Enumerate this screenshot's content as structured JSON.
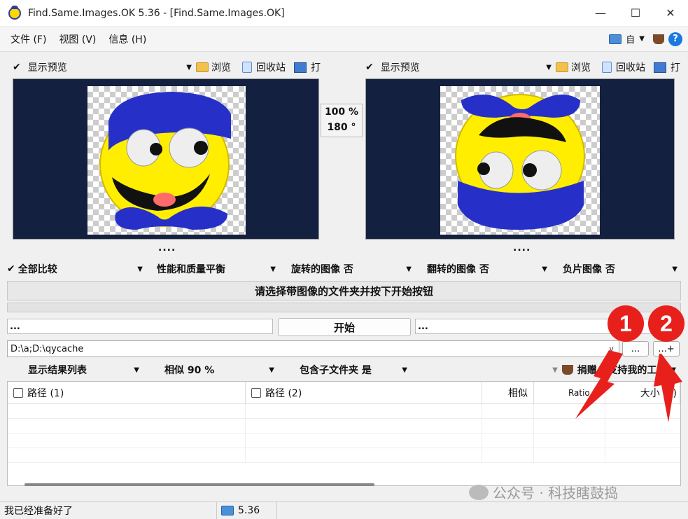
{
  "window": {
    "title": "Find.Same.Images.OK 5.36 - [Find.Same.Images.OK]",
    "minimize": "—",
    "maximize": "☐",
    "close": "✕"
  },
  "menu": {
    "items": [
      "文件 (F)",
      "视图 (V)",
      "信息 (H)"
    ],
    "right_label": "自",
    "help": "?"
  },
  "left_preview": {
    "show_preview": "显示预览",
    "browse": "浏览",
    "recycle": "回收站",
    "open": "打",
    "dots": "...."
  },
  "right_preview": {
    "show_preview": "显示预览",
    "browse": "浏览",
    "recycle": "回收站",
    "open": "打",
    "dots": "...."
  },
  "middle": {
    "zoom": "100 %",
    "rotation": "180 °"
  },
  "options": {
    "compare": "全部比较",
    "balance": "性能和质量平衡",
    "rotated": "旋转的图像 否",
    "flipped": "翻转的图像 否",
    "negative": "负片图像 否"
  },
  "banner": "请选择带图像的文件夹并按下开始按钮",
  "status_left": "...",
  "status_right": "...",
  "start_button": "开始",
  "path": {
    "value": "D:\\a;D:\\qycache",
    "browse_btn": "...",
    "add_btn": "...+"
  },
  "options2": {
    "show_list": "显示结果列表",
    "similarity": "相似 90 %",
    "subfolders": "包含子文件夹 是",
    "donate": "捐赠 - 支持我的工..."
  },
  "table": {
    "columns": [
      "路径 (1)",
      "路径 (2)",
      "相似",
      "Ratio %",
      "大小 (1)"
    ]
  },
  "statusbar": {
    "ready": "我已经准备好了",
    "version": "5.36"
  },
  "watermark": "公众号 · 科技瞎鼓捣",
  "annotations": [
    "1",
    "2"
  ],
  "colors": {
    "preview_bg": "#14203f",
    "badge": "#e8201c",
    "smiley_yellow": "#ffee00",
    "hat_blue": "#2630c8"
  }
}
